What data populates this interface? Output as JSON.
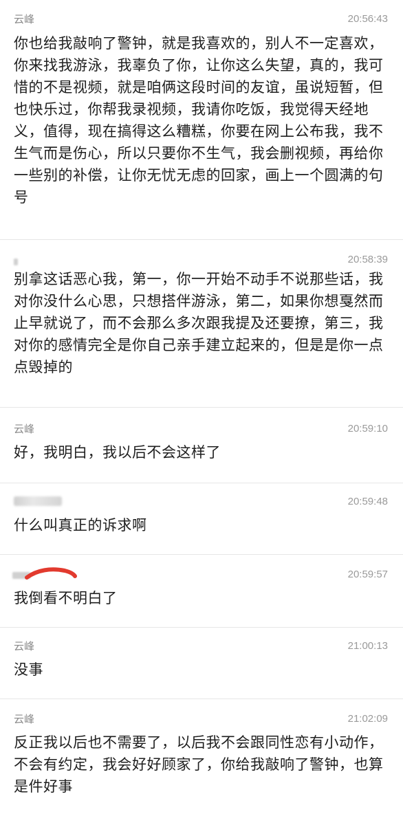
{
  "messages": [
    {
      "sender": "云峰",
      "time": "20:56:43",
      "text": "你也给我敲响了警钟，就是我喜欢的，别人不一定喜欢，你来找我游泳，我辜负了你，让你这么失望，真的，我可惜的不是视频，就是咱俩这段时间的友谊，虽说短暂，但也快乐过，你帮我录视频，我请你吃饭，我觉得天经地义，值得，现在搞得这么糟糕，你要在网上公布我，我不生气而是伤心，所以只要你不生气，我会删视频，再给你一些别的补偿，让你无忧无虑的回家，画上一个圆满的句号"
    },
    {
      "sender": "",
      "time": "20:58:39",
      "text": "别拿这话恶心我，第一，你一开始不动手不说那些话，我对你没什么心思，只想搭伴游泳，第二，如果你想戛然而止早就说了，而不会那么多次跟我提及还要撩，第三，我对你的感情完全是你自己亲手建立起来的，但是是你一点点毁掉的"
    },
    {
      "sender": "云峰",
      "time": "20:59:10",
      "text": "好，我明白，我以后不会这样了"
    },
    {
      "sender": "",
      "time": "20:59:48",
      "text": "什么叫真正的诉求啊"
    },
    {
      "sender": "",
      "time": "20:59:57",
      "text": "我倒看不明白了"
    },
    {
      "sender": "云峰",
      "time": "21:00:13",
      "text": "没事"
    },
    {
      "sender": "云峰",
      "time": "21:02:09",
      "text": "反正我以后也不需要了，以后我不会跟同性恋有小动作，不会有约定，我会好好顾家了，你给我敲响了警钟，也算是件好事"
    }
  ]
}
